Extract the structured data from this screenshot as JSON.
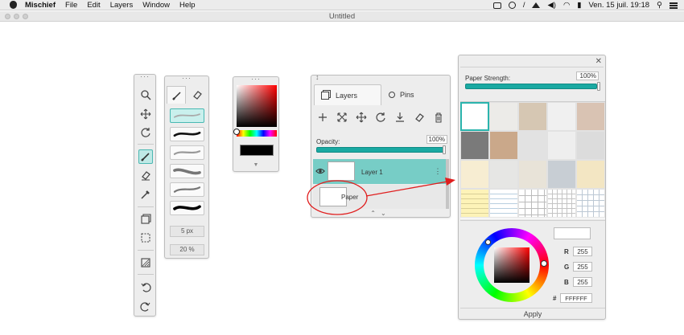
{
  "menubar": {
    "app_name": "Mischief",
    "items": [
      "File",
      "Edit",
      "Layers",
      "Window",
      "Help"
    ],
    "clock": "Ven. 15 juil.  19:18"
  },
  "window": {
    "title": "Untitled"
  },
  "brush_panel": {
    "size_value": "5 px",
    "opacity_value": "20 %"
  },
  "layers_panel": {
    "tab_layers": "Layers",
    "tab_pins": "Pins",
    "opacity_label": "Opacity:",
    "opacity_value": "100%",
    "opacity_fraction": 1.0,
    "layers": [
      {
        "name": "Layer 1",
        "selected": true
      },
      {
        "name": "Paper",
        "selected": false
      }
    ]
  },
  "paper_panel": {
    "strength_label": "Paper Strength:",
    "strength_value": "100%",
    "strength_fraction": 1.0,
    "selected_texture_index": 0,
    "color": {
      "r": "255",
      "g": "255",
      "b": "255",
      "hex": "FFFFFF",
      "r_label": "R",
      "g_label": "G",
      "b_label": "B",
      "hash": "#"
    },
    "apply_label": "Apply"
  },
  "colors": {
    "accent": "#1aa9a2",
    "layer_selected": "#77cdc6",
    "annotation": "#e01e1e"
  }
}
